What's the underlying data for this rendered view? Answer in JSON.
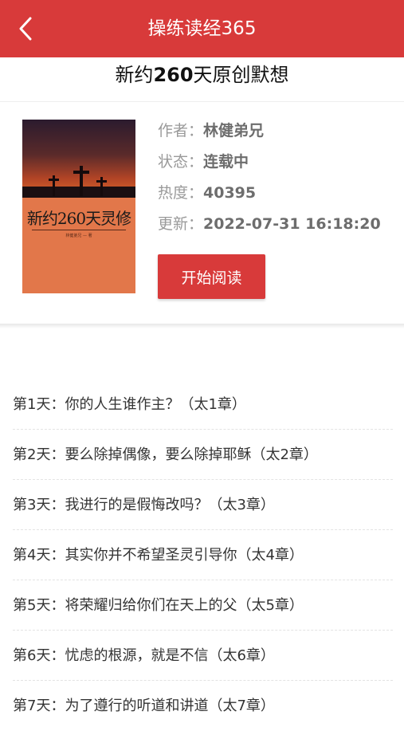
{
  "header": {
    "back_icon": "chevron-left-icon",
    "title": "操练读经365"
  },
  "book": {
    "title_prefix": "新约",
    "title_number": "260",
    "title_suffix": "天原创默想",
    "cover_title": "新约260天灵修",
    "cover_author": "林健弟兄 — 著",
    "author_label": "作者：",
    "author": "林健弟兄",
    "status_label": "状态：",
    "status": "连载中",
    "heat_label": "热度：",
    "heat": "40395",
    "updated_label": "更新：",
    "updated": "2022-07-31 16:18:20",
    "read_button": "开始阅读"
  },
  "chapters": [
    {
      "label": "第1天：你的人生谁作主？（太1章）"
    },
    {
      "label": "第2天：要么除掉偶像，要么除掉耶稣（太2章）"
    },
    {
      "label": "第3天：我进行的是假悔改吗？（太3章）"
    },
    {
      "label": "第4天：其实你并不希望圣灵引导你（太4章）"
    },
    {
      "label": "第5天：将荣耀归给你们在天上的父（太5章）"
    },
    {
      "label": "第6天：忧虑的根源，就是不信（太6章）"
    },
    {
      "label": "第7天：为了遵行的听道和讲道（太7章）"
    }
  ],
  "colors": {
    "brand_red": "#d83a3a"
  }
}
